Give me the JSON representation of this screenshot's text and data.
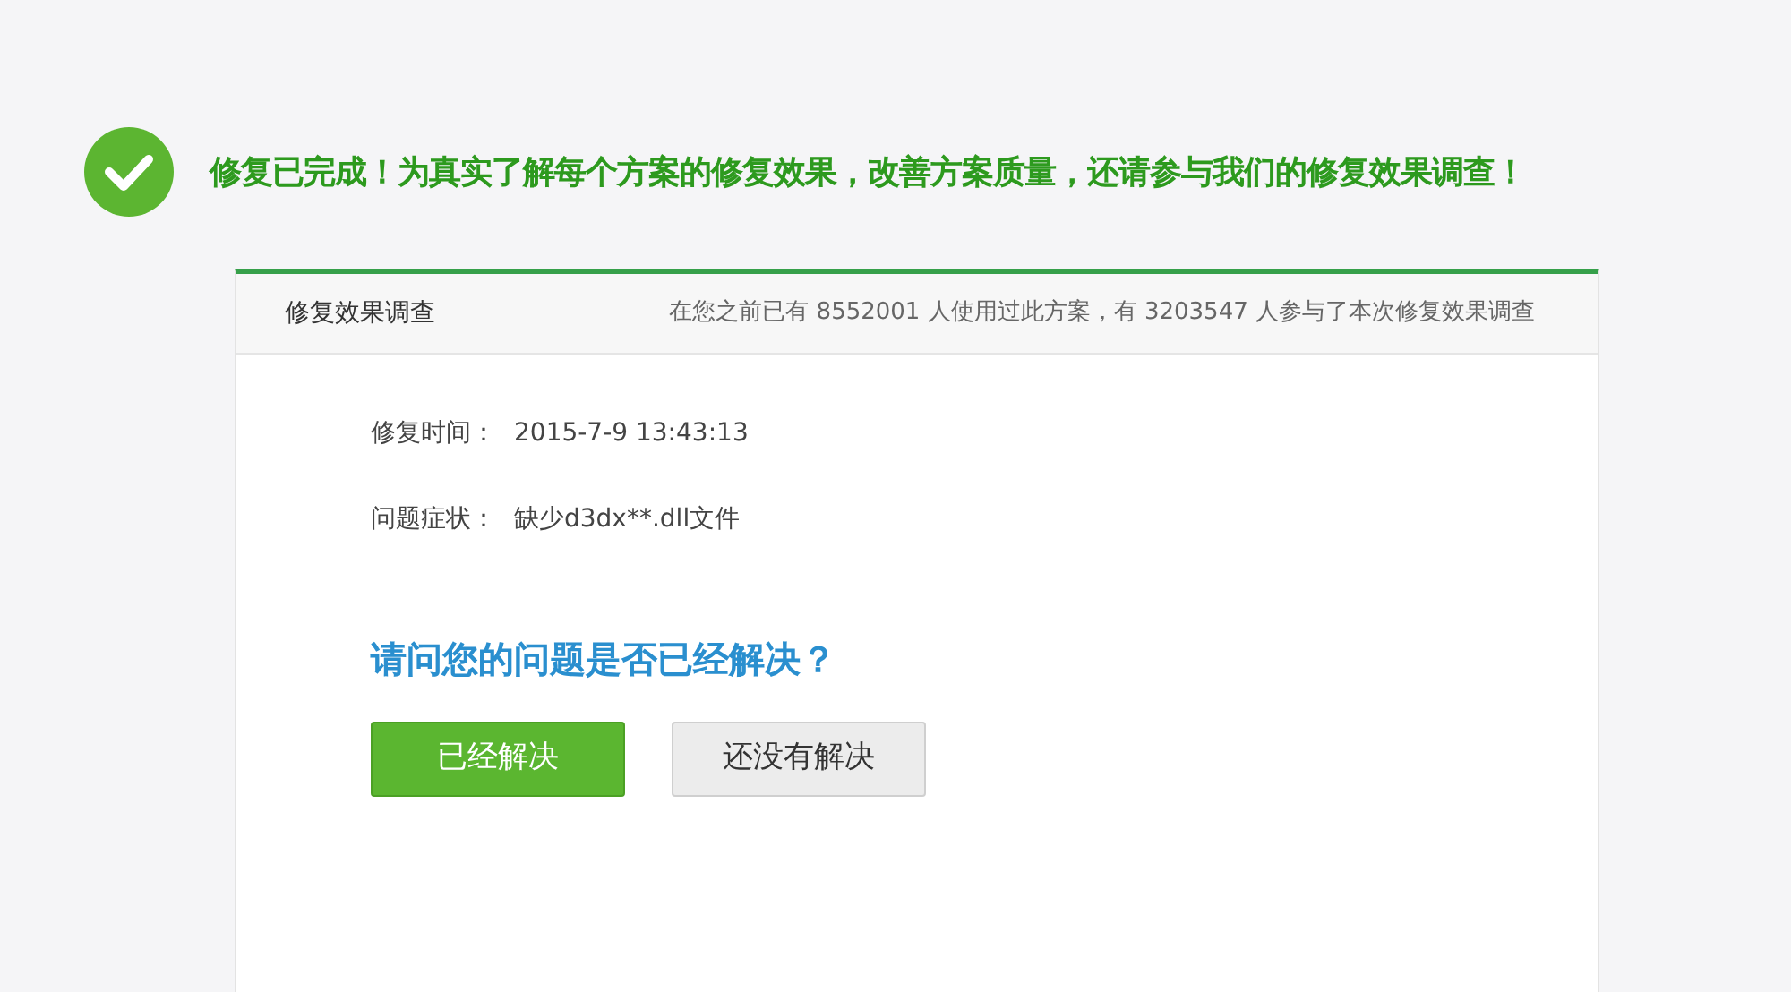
{
  "banner": {
    "message": "修复已完成！为真实了解每个方案的修复效果，改善方案质量，还请参与我们的修复效果调查！"
  },
  "survey": {
    "title": "修复效果调查",
    "stats": "在您之前已有 8552001 人使用过此方案，有 3203547 人参与了本次修复效果调查",
    "fields": [
      {
        "label": "修复时间：",
        "value": "2015-7-9 13:43:13"
      },
      {
        "label": "问题症状：",
        "value": "缺少d3dx**.dll文件"
      }
    ],
    "question": "请问您的问题是否已经解决？",
    "buttons": [
      {
        "label": "已经解决",
        "kind": "primary"
      },
      {
        "label": "还没有解决",
        "kind": "secondary"
      }
    ]
  }
}
